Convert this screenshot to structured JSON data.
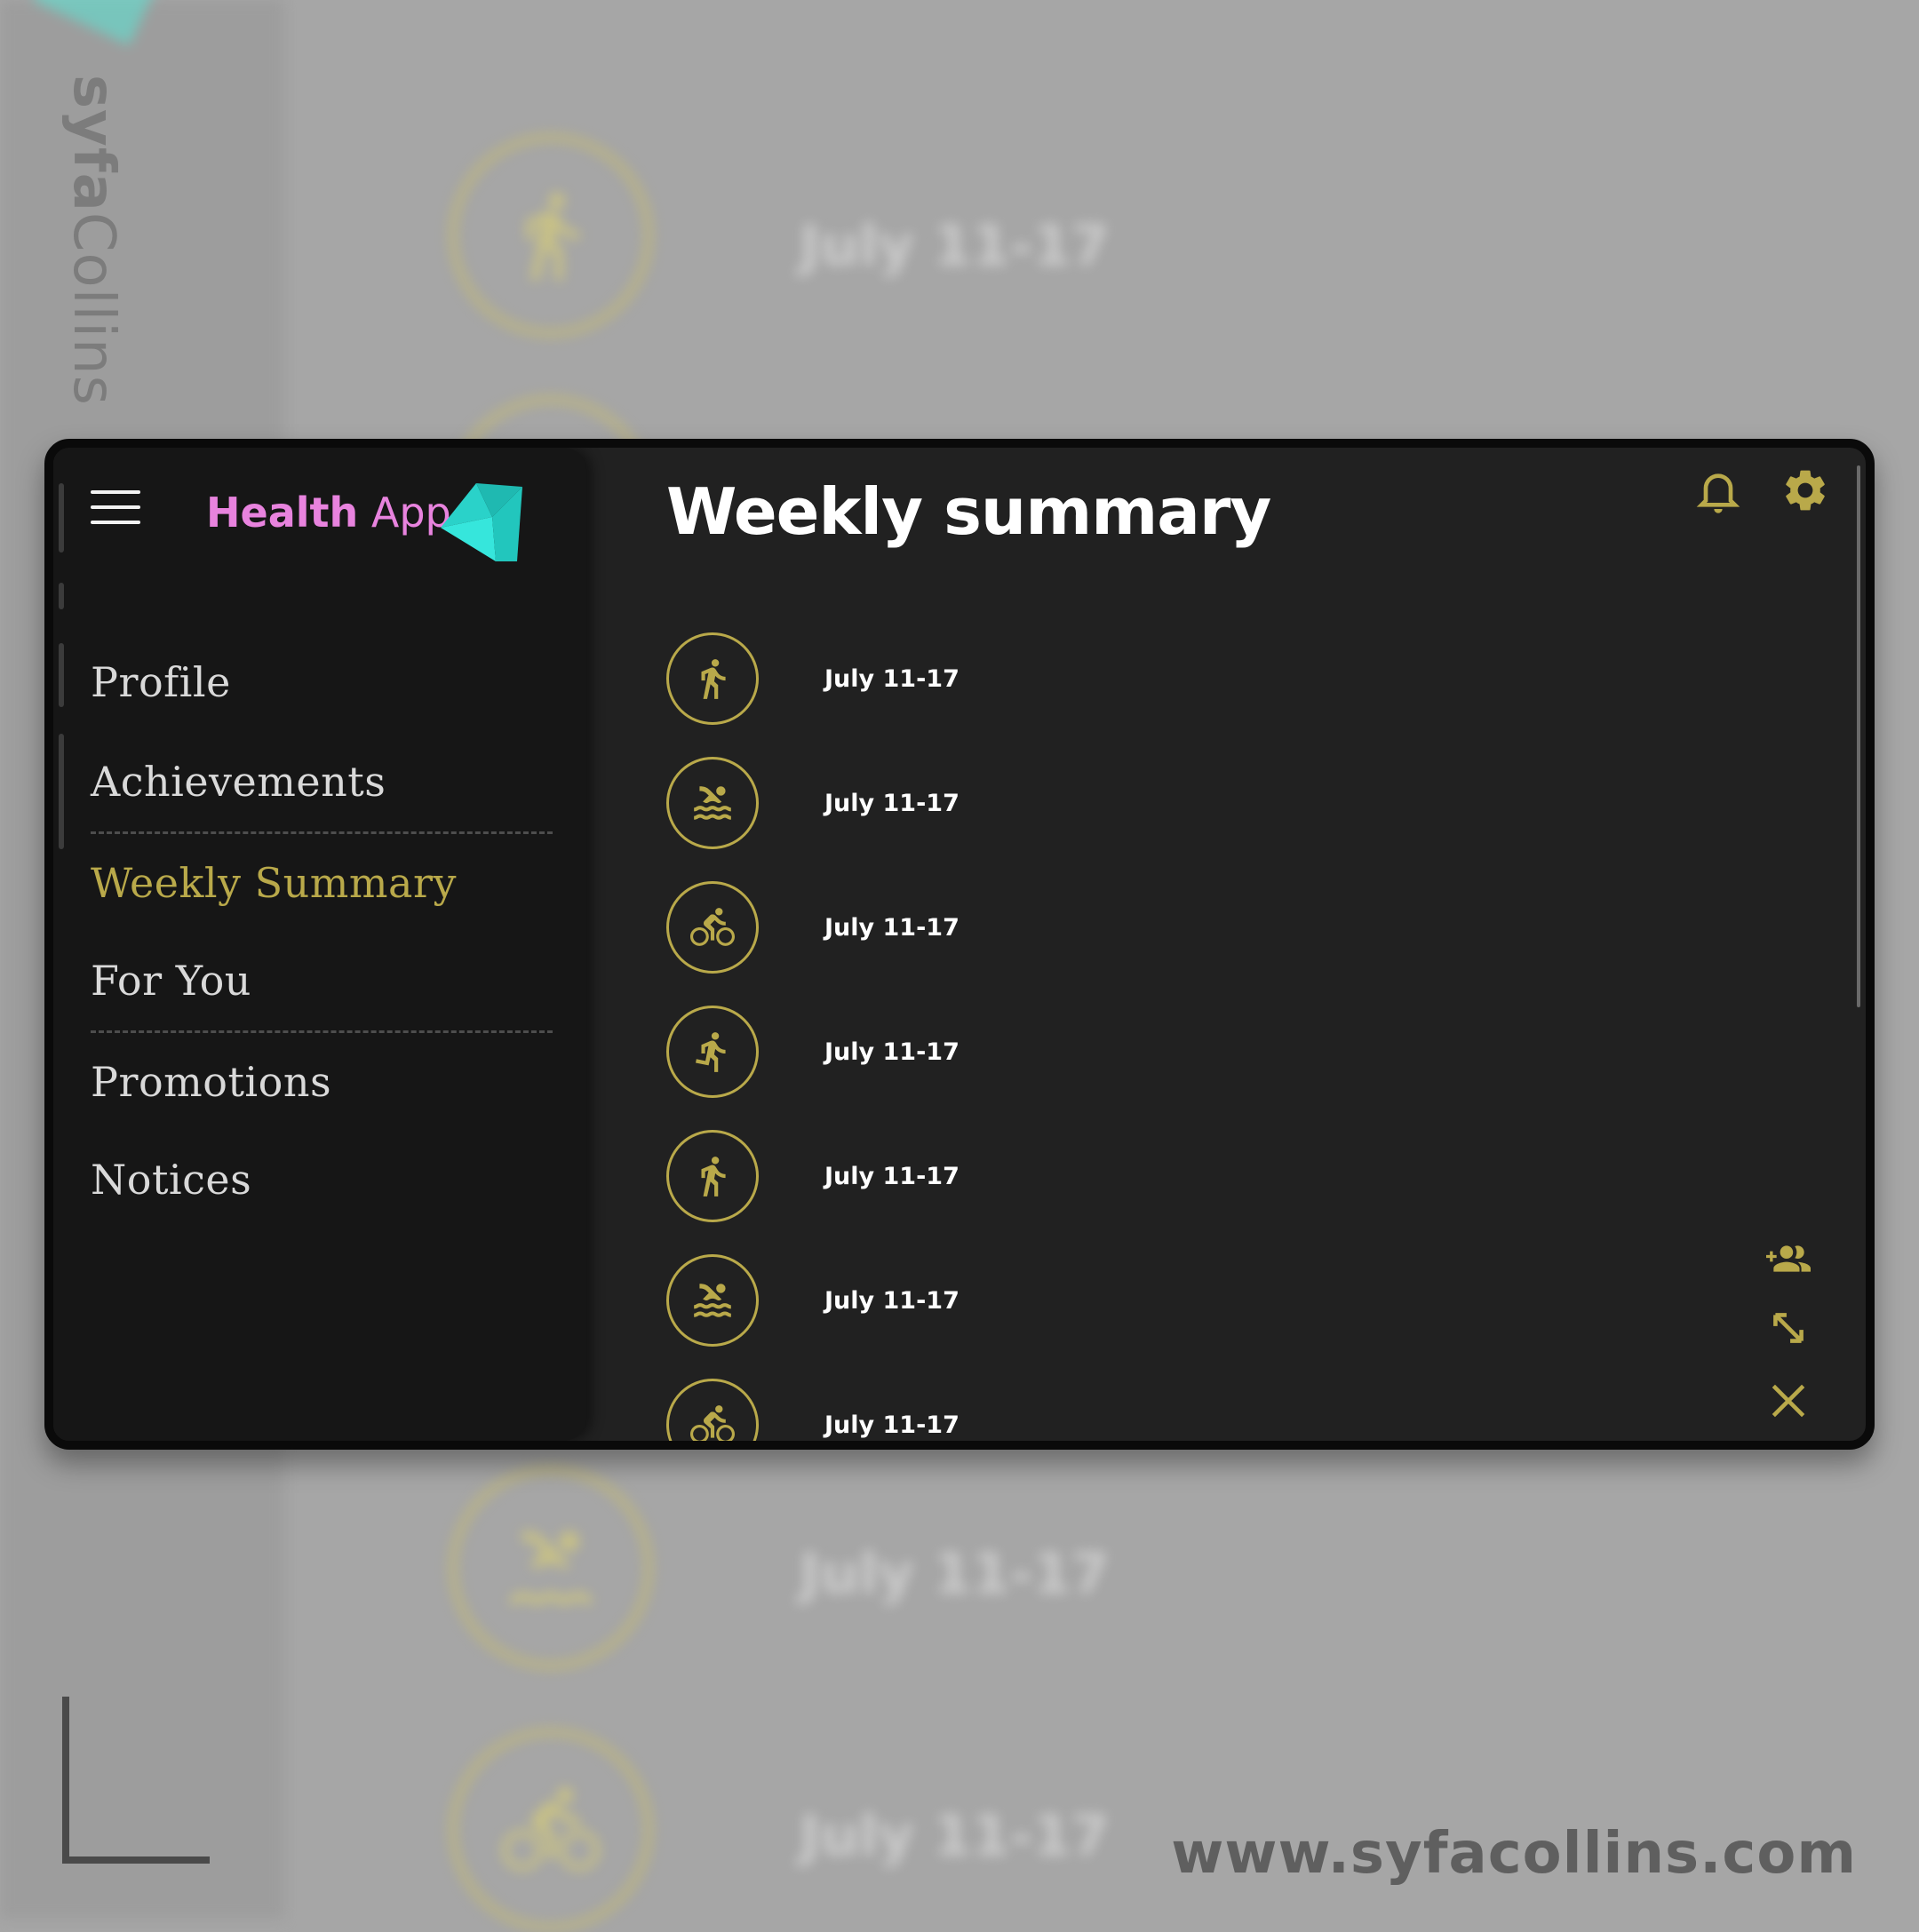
{
  "background": {
    "rows": [
      {
        "date": "July 11-17"
      },
      {
        "date": "July 11-17"
      },
      {
        "date": "July 11-17"
      }
    ]
  },
  "branding": {
    "vertical_bold": "syfa",
    "vertical_regular": "Collins",
    "url": "www.syfacollins.com"
  },
  "app": {
    "title_bold": "Health",
    "title_regular": " App"
  },
  "sidebar": {
    "items": [
      {
        "label": "Profile"
      },
      {
        "label": "Achievements"
      },
      {
        "label": "Weekly Summary",
        "active": true
      },
      {
        "label": "For You"
      },
      {
        "label": "Promotions"
      },
      {
        "label": "Notices"
      }
    ]
  },
  "main": {
    "title": "Weekly summary",
    "activities": [
      {
        "icon": "walking-icon",
        "date": "July 11-17"
      },
      {
        "icon": "swimming-icon",
        "date": "July 11-17"
      },
      {
        "icon": "cycling-icon",
        "date": "July 11-17"
      },
      {
        "icon": "running-icon",
        "date": "July 11-17"
      },
      {
        "icon": "walking-icon",
        "date": "July 11-17"
      },
      {
        "icon": "swimming-icon",
        "date": "July 11-17"
      },
      {
        "icon": "cycling-icon",
        "date": "July 11-17"
      }
    ]
  },
  "toolbar": {
    "icons": [
      "bell-icon",
      "gear-icon"
    ],
    "actions": [
      "add-friend-icon",
      "expand-icon",
      "close-icon"
    ]
  },
  "colors": {
    "accent_gold": "#b9a94a",
    "title_pink": "#e883de",
    "logo_teal": "#2ad2c9",
    "window_bg": "#212121",
    "sidebar_bg": "#161616"
  }
}
